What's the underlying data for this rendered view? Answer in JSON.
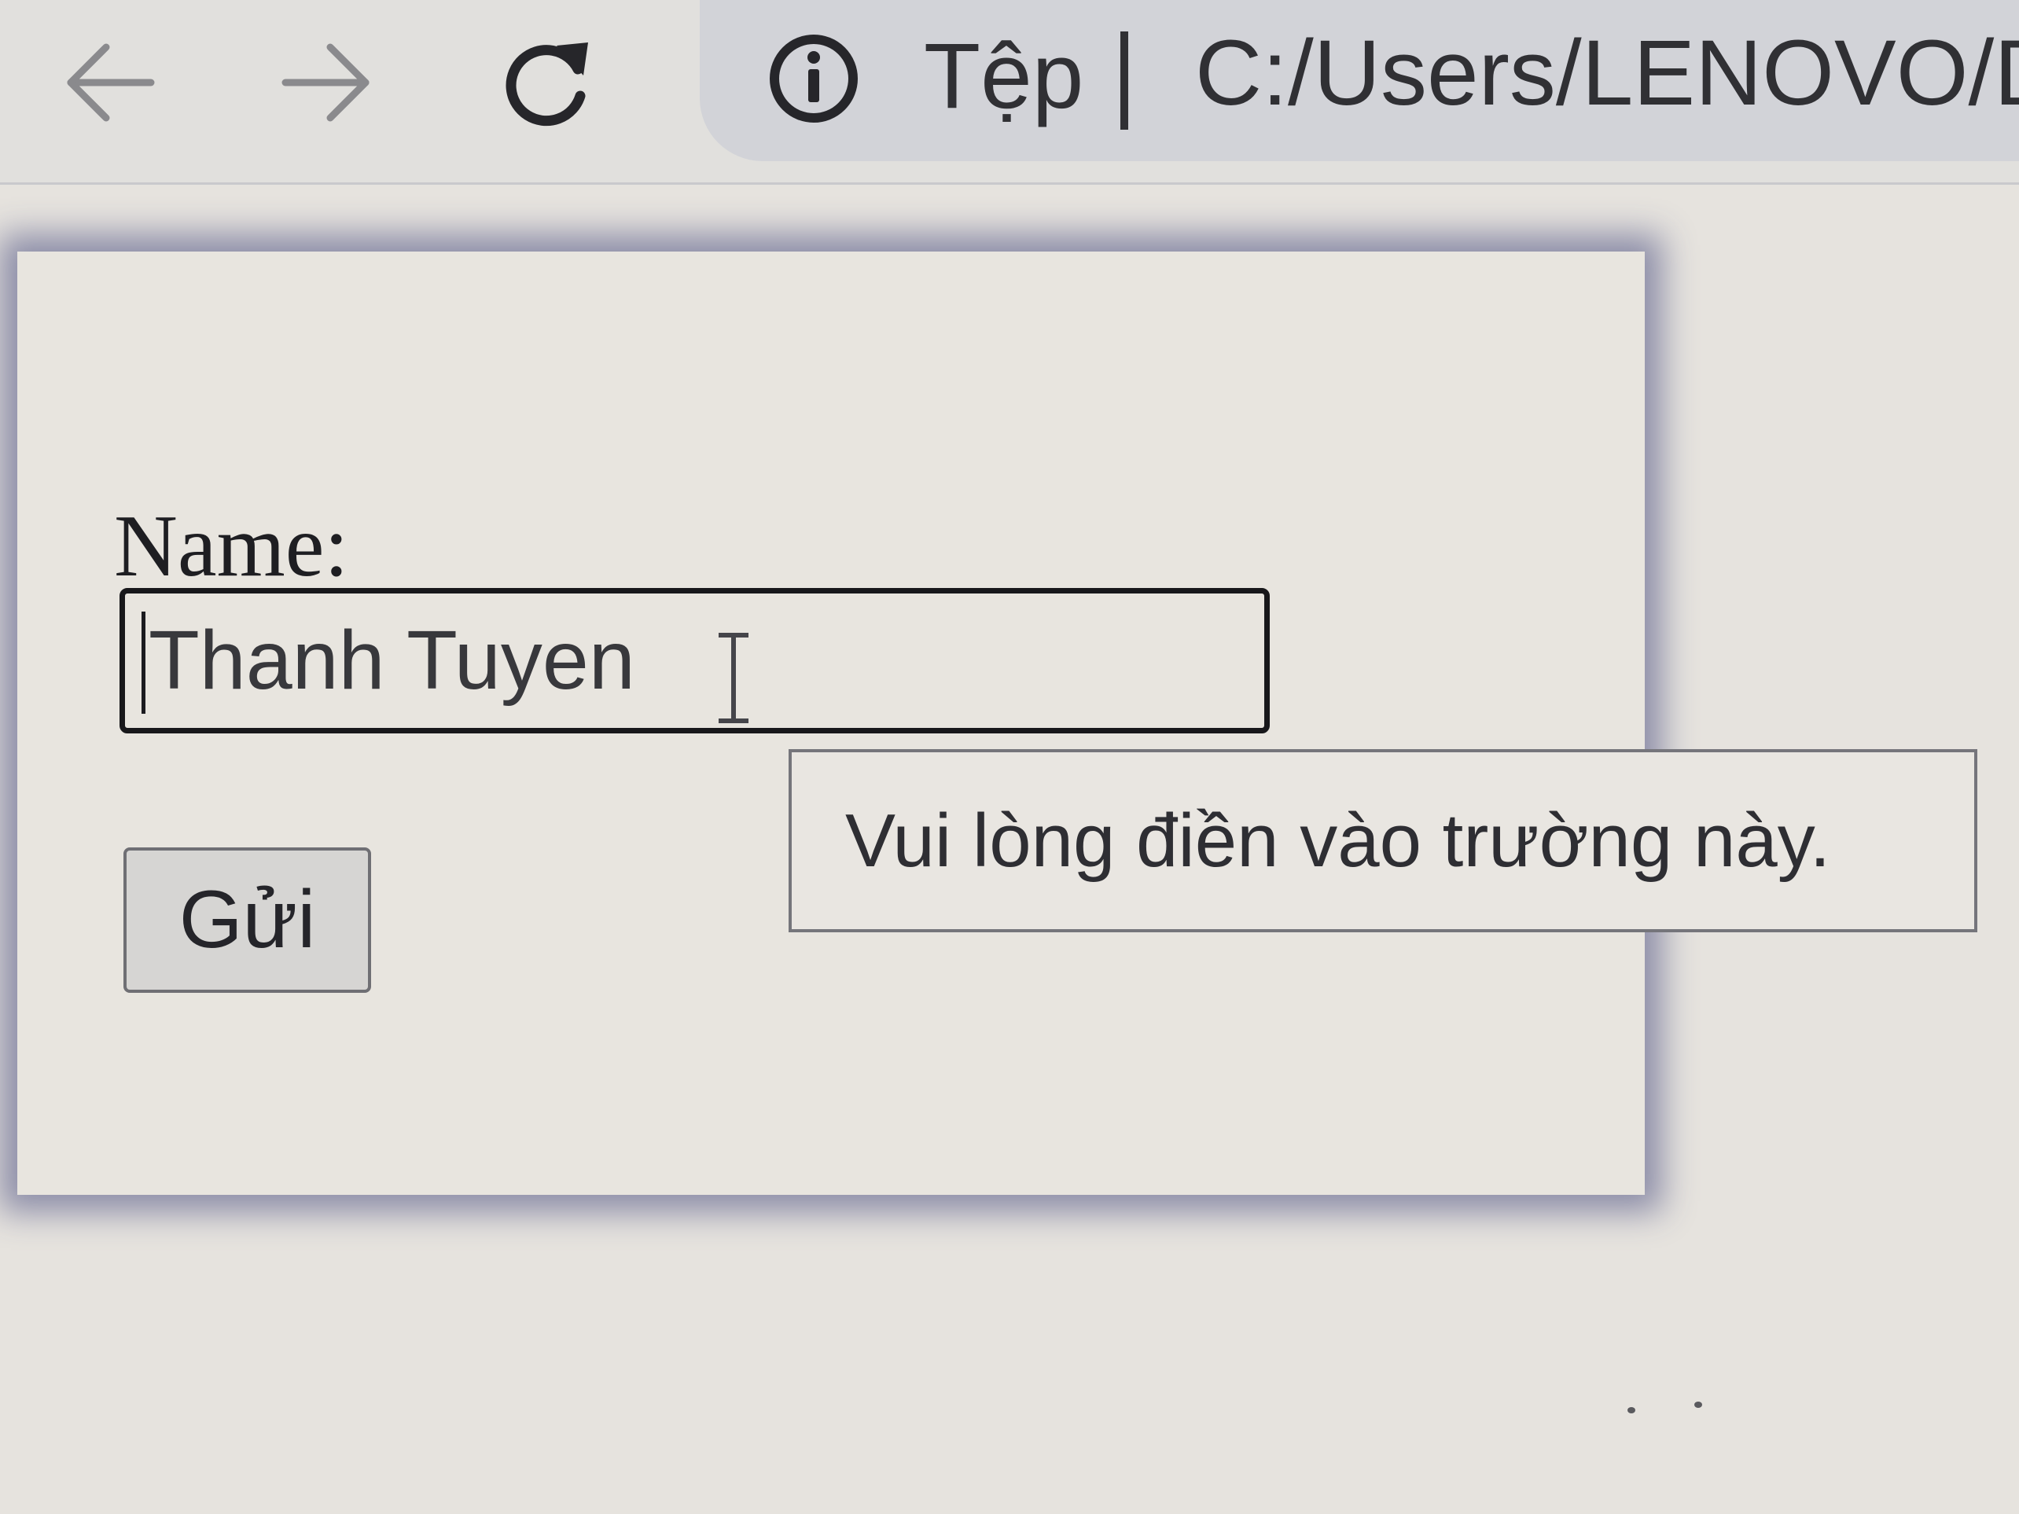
{
  "browser": {
    "back_icon": "arrow-left-icon",
    "forward_icon": "arrow-right-icon",
    "reload_icon": "reload-icon",
    "info_icon": "info-circle-icon",
    "scheme_label": "Tệp",
    "url": "C:/Users/LENOVO/D"
  },
  "form": {
    "name_label": "Name:",
    "name_value": "Thanh Tuyen",
    "submit_label": "Gửi",
    "validation_tooltip": "Vui lòng điền vào trường này."
  },
  "colors": {
    "page_background": "#e6e3de",
    "card_shadow": "#8c8da8",
    "address_bar": "#d2d3d8",
    "input_border": "#18181b"
  }
}
